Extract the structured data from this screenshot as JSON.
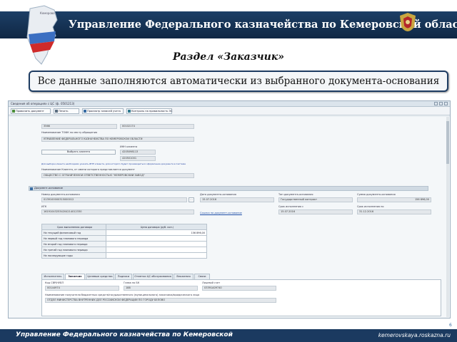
{
  "header": {
    "title": "Управление Федерального казначейства по Кемеровской области",
    "region_label": "Кемерово"
  },
  "section_title": "Раздел «Заказчик»",
  "note": "Все данные заполняются автоматически из выбранного документа-основания",
  "app": {
    "window_title": "Сведения об операциях с ЦС (ф. 0501213)",
    "toolbar": [
      {
        "label": "Провалить документ",
        "icon": "checkmark-icon"
      },
      {
        "label": "Печать",
        "icon": "printer-icon"
      },
      {
        "label": "Просмотр записей учета",
        "icon": "list-icon"
      },
      {
        "label": "Контроль на правильность ЭС",
        "icon": "shield-icon"
      }
    ],
    "fields": {
      "code_1": "3566",
      "code_2": "00102174",
      "tofk_label": "Наименование ТОФК по месту обращения",
      "tofk_value": "УПРАВЛЕНИЕ ФЕДЕРАЛЬНОГО КАЗНАЧЕЙСТВА ПО КЕМЕРОВСКОЙ ОБЛАСТИ",
      "select_client_button": "Выбрать клиента",
      "inn_label": "ИНН клиента",
      "inn_value": "4205098113",
      "kpp_value": "420501001",
      "warning_text": "Для выбора клиента необходимо указать ИНН клиента, для которого будет производиться оформление документа в Системе",
      "client_name_label": "Наименование Клиента, от имени которого представляется документ",
      "client_name_value": "ОБЩЕСТВО С ОГРАНИЧЕННОЙ ОТВЕТСТВЕННОСТЬЮ \"КЕМЕРОВСКИЙ ЗАВОД\""
    },
    "doc_section": {
      "title": "Документ-основание",
      "num_label": "Номер документа-основания",
      "num_value": "0139100000315000012",
      "date_label": "Дата документа-основания",
      "date_value": "15.07.2016",
      "type_label": "Тип документа-основания",
      "type_value": "Государственный контракт",
      "sum_label": "Сумма документа-основания",
      "sum_value": "156 896,00",
      "ikz_label": "ИГК",
      "ikz_value": "161910432534204214012330",
      "link_text": "Ссылка на документ-основание",
      "start_label": "Срок исполнения с",
      "start_value": "15.07.2016",
      "end_label": "Срок исполнения по",
      "end_value": "31.12.2016"
    },
    "period_table": {
      "col_header": "Срок выполнения договора",
      "price_header": "Цена договора (руб. коп.)",
      "rows": [
        {
          "label": "На текущий финансовый год",
          "value": "156 896,00"
        },
        {
          "label": "На первый год планового периода",
          "value": ""
        },
        {
          "label": "На второй год планового периода",
          "value": ""
        },
        {
          "label": "На третий год планового периода",
          "value": ""
        },
        {
          "label": "На последующие годы",
          "value": ""
        }
      ]
    },
    "tabs": [
      "Исполнитель",
      "Заказчик",
      "Целевые средства",
      "Подписи",
      "Отметки ЦС обслуживания",
      "Вложения",
      "Связи"
    ],
    "customer": {
      "svr_label": "Код СВР/НУБП",
      "svr_value": "00144974",
      "glava_label": "Глава по БК",
      "glava_value": "188",
      "account_label": "Лицевой счет",
      "account_value": "03391A09740",
      "recipient_label": "Наименование получателя бюджетных средств/государственного (муниципального) заказчика/юридического лица",
      "recipient_value": "ОТДЕЛ МИНИСТЕРСТВА ВНУТРЕННИХ ДЕЛ РОССИЙСКОЙ ФЕДЕРАЦИИ ПО ГОРОДУ БЕЛОВО"
    }
  },
  "page_number": "6",
  "footer": {
    "left": "Управление Федерального казначейства по Кемеровской",
    "right": "kemerovskaya.roskazna.ru"
  }
}
